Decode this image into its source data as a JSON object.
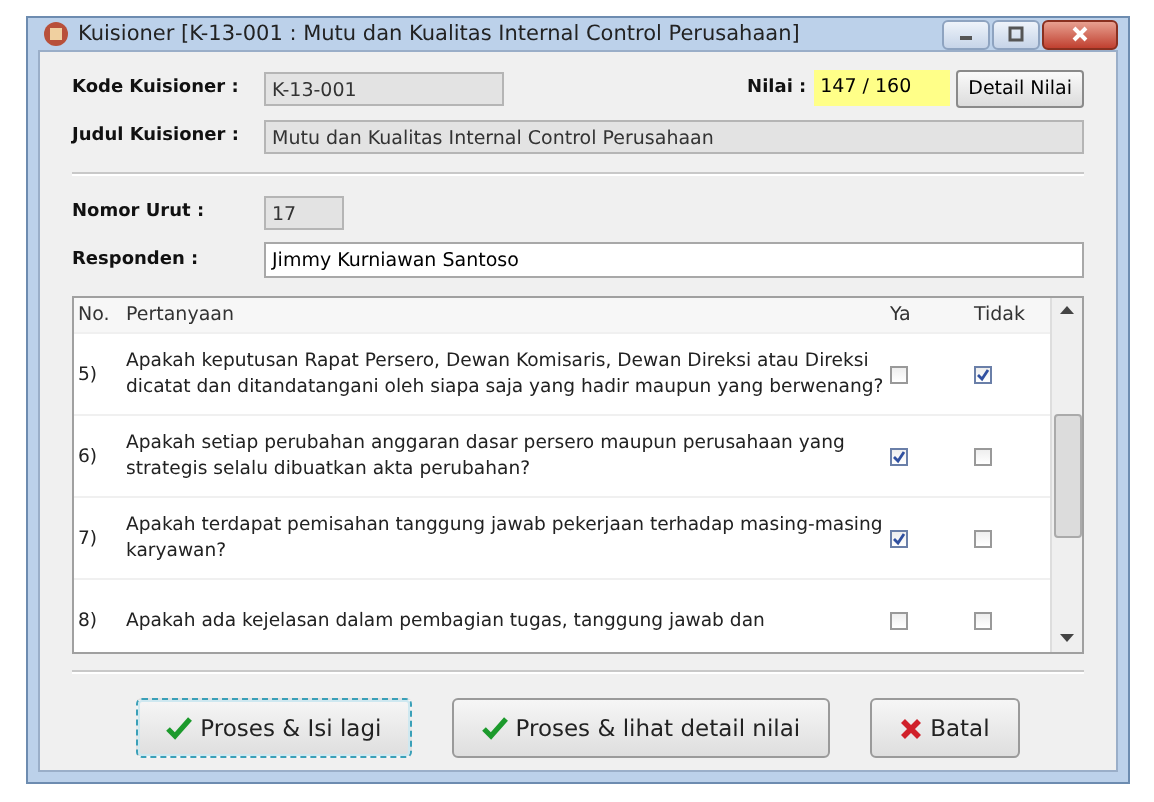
{
  "window": {
    "title": "Kuisioner [K-13-001 : Mutu dan Kualitas Internal Control Perusahaan]"
  },
  "fields": {
    "kode_label": "Kode Kuisioner :",
    "kode_value": "K-13-001",
    "nilai_label": "Nilai :",
    "nilai_value": "147 / 160",
    "detail_button": "Detail Nilai",
    "judul_label": "Judul Kuisioner :",
    "judul_value": "Mutu dan Kualitas Internal Control Perusahaan",
    "nomor_label": "Nomor Urut :",
    "nomor_value": "17",
    "responden_label": "Responden :",
    "responden_value": "Jimmy Kurniawan Santoso"
  },
  "table": {
    "columns": [
      "No.",
      "Pertanyaan",
      "Ya",
      "Tidak"
    ],
    "rows": [
      {
        "no": "5)",
        "question": "Apakah keputusan Rapat Persero, Dewan Komisaris, Dewan Direksi atau Direksi dicatat dan ditandatangani oleh siapa saja yang hadir maupun yang berwenang?",
        "ya": false,
        "tidak": true
      },
      {
        "no": "6)",
        "question": "Apakah setiap perubahan anggaran dasar persero maupun perusahaan yang strategis selalu dibuatkan akta perubahan?",
        "ya": true,
        "tidak": false
      },
      {
        "no": "7)",
        "question": "Apakah terdapat pemisahan tanggung jawab pekerjaan terhadap masing-masing karyawan?",
        "ya": true,
        "tidak": false
      },
      {
        "no": "8)",
        "question": "Apakah ada kejelasan dalam pembagian tugas, tanggung jawab dan",
        "ya": false,
        "tidak": false
      }
    ]
  },
  "buttons": [
    {
      "label": "Proses & Isi lagi",
      "kind": "ok",
      "focused": true
    },
    {
      "label": "Proses & lihat detail nilai",
      "kind": "ok",
      "focused": false
    },
    {
      "label": "Batal",
      "kind": "cancel",
      "focused": false
    }
  ]
}
